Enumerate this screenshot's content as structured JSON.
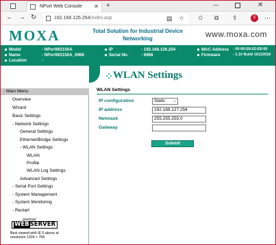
{
  "browser": {
    "tab_title": "NPort Web Console",
    "url_host": "192.168.126.254",
    "url_path": "/index.asp",
    "ext_badge": "S"
  },
  "header": {
    "logo": "MOXA",
    "tagline": "Total Solution for Industrial Device Networking",
    "site": "www.moxa.com"
  },
  "info": {
    "model_label": "Model",
    "model_value": "- NPortW2150A",
    "name_label": "Name",
    "name_value": "- NPortW2150A_6966",
    "location_label": "Location",
    "location_value": "-",
    "ip_label": "IP",
    "ip_value": "- 192.168.126.254",
    "serial_label": "Serial No.",
    "serial_value": "- 6966",
    "mac_label": "MAC Address",
    "mac_value": "- 00:90:E8:62:E8:60",
    "firmware_label": "Firmware",
    "firmware_value": "- 1.10 Build 16113018"
  },
  "sidebar": {
    "main_menu": "- Main Menu",
    "items": [
      {
        "label": "Overview"
      },
      {
        "label": "Wizard"
      },
      {
        "label": "Basic Settings"
      },
      {
        "label": "- Network Settings"
      },
      {
        "label": "General Settings"
      },
      {
        "label": "Ethernet/Bridge Settings"
      },
      {
        "label": "- WLAN Settings"
      },
      {
        "label": "WLAN"
      },
      {
        "label": "Profile"
      },
      {
        "label": "WLAN Log Settings"
      },
      {
        "label": "Advanced Settings"
      },
      {
        "label": "- Serial Port Settings"
      },
      {
        "label": "- System Management"
      },
      {
        "label": "- System Monitoring"
      },
      {
        "label": "- Restart"
      }
    ],
    "webserver_small": "goahead",
    "webserver_big_a": "WEB",
    "webserver_big_b": "SERVER",
    "best_viewed": "Best viewed with IE 5 above at",
    "resolution": "resolution 1024 × 768"
  },
  "main": {
    "page_title": "WLAN Settings",
    "section": "WLAN Settings",
    "ip_config_label": "IP configuration",
    "ip_config_value": "Static",
    "ip_address_label": "IP address",
    "ip_address_value": "192.168.127.254",
    "netmask_label": "Netmask",
    "netmask_value": "255.255.255.0",
    "gateway_label": "Gateway",
    "gateway_value": "",
    "submit_label": "Submit"
  },
  "colors": {
    "brand_green": "#0a8a6b",
    "frame_red": "#c8102e"
  }
}
